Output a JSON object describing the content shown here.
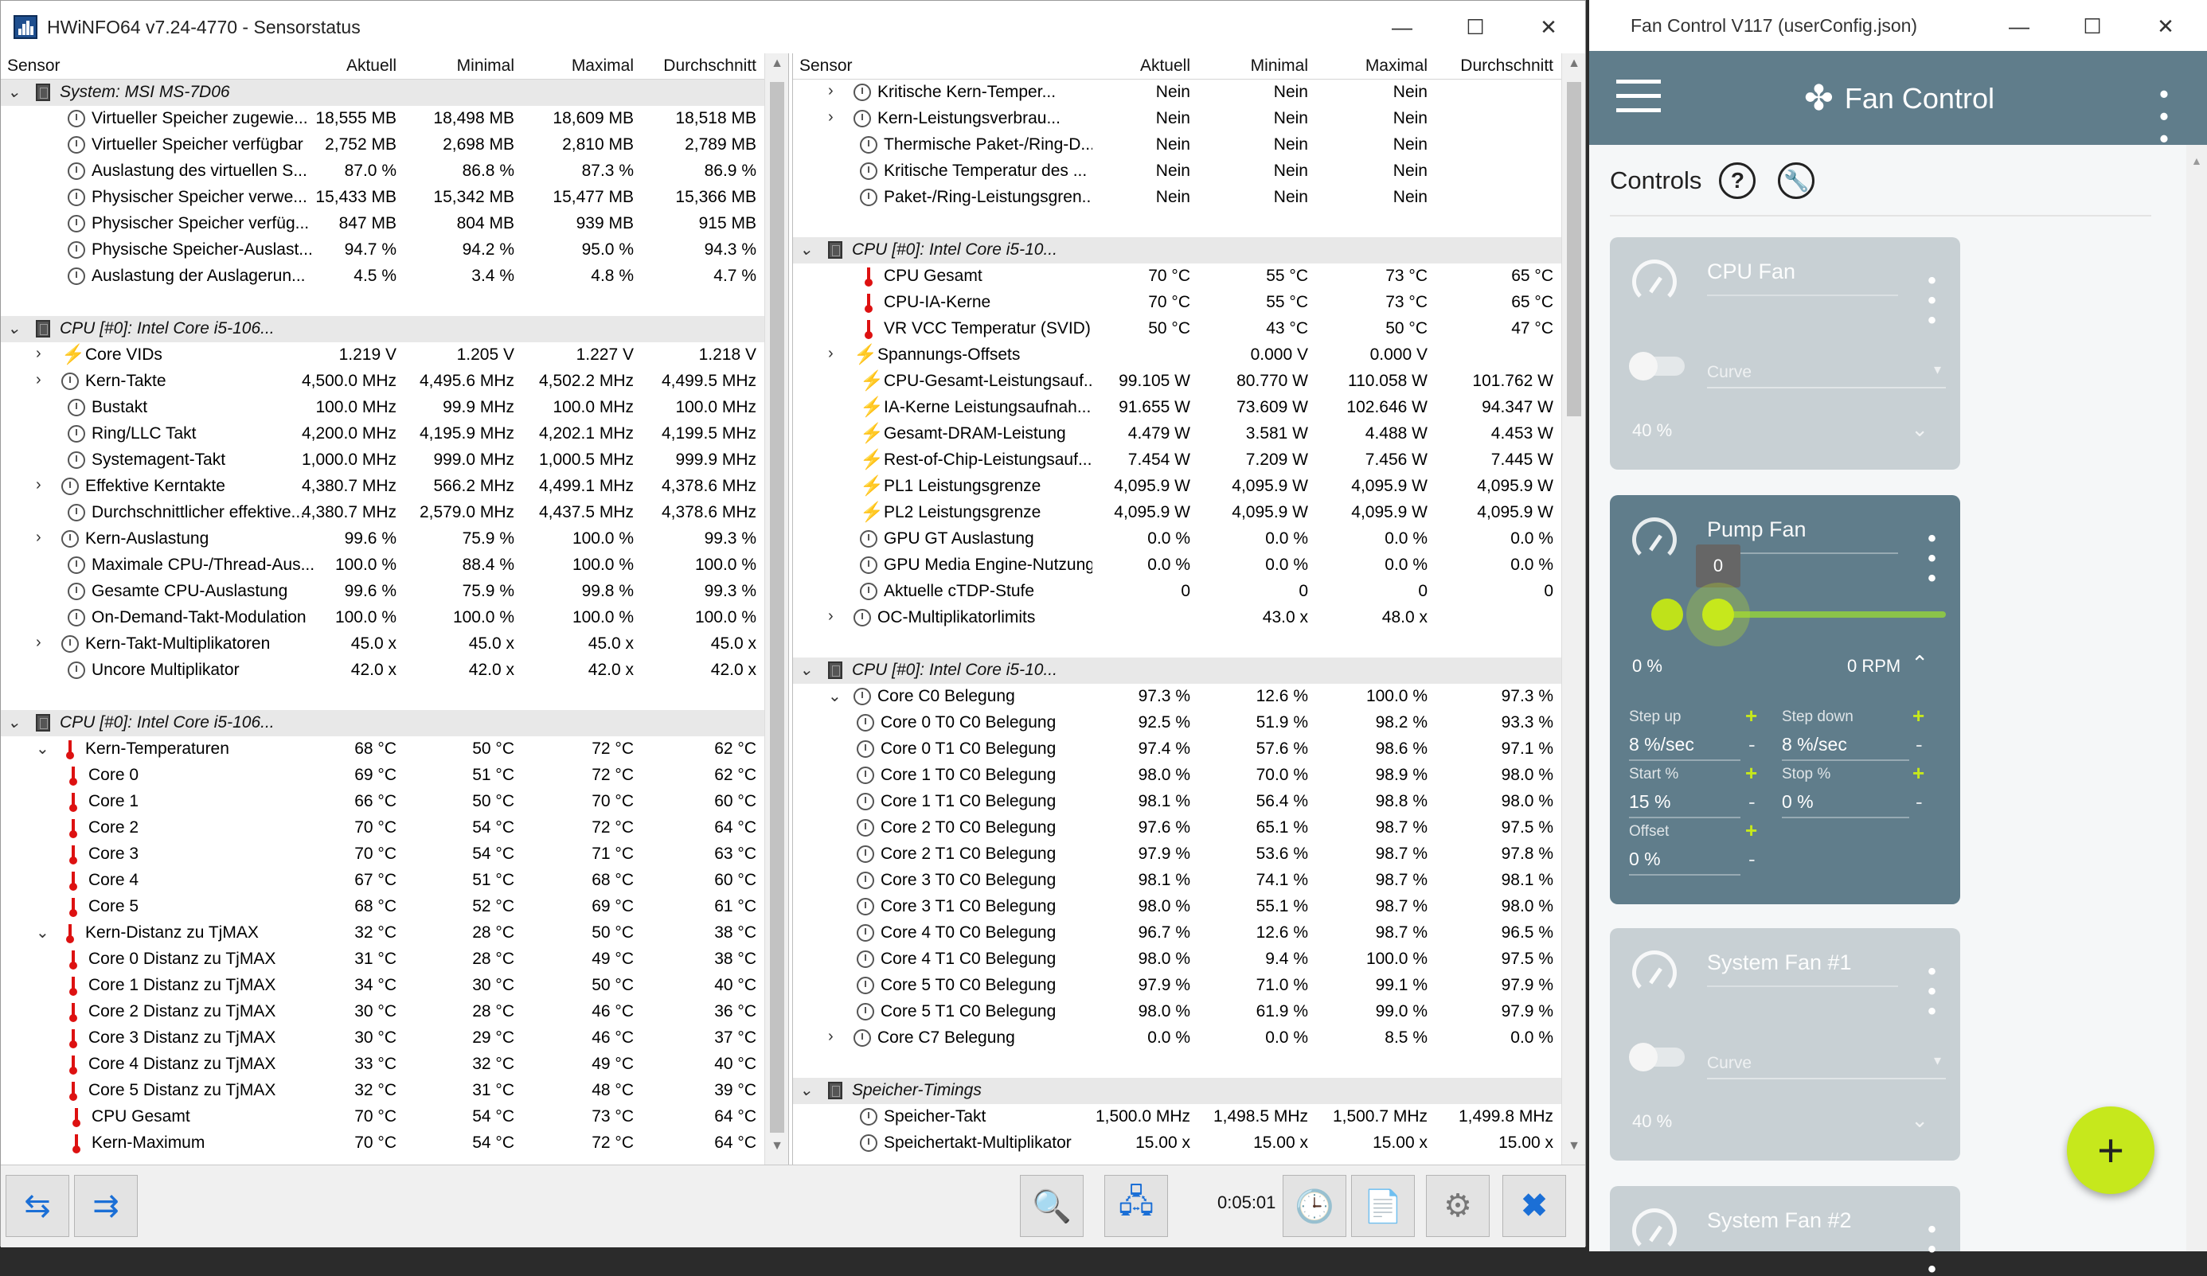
{
  "hw": {
    "title": "HWiNFO64 v7.24-4770 - Sensorstatus",
    "timer": "0:05:01",
    "headers": {
      "sensor": "Sensor",
      "current": "Aktuell",
      "min": "Minimal",
      "max": "Maximal",
      "avg": "Durchschnitt"
    },
    "left_rows": [
      {
        "t": "g",
        "d": 0,
        "exp": "⌄",
        "icon": "chip",
        "name": "System: MSI MS-7D06"
      },
      {
        "d": 1,
        "icon": "clk",
        "name": "Virtueller Speicher zugewie...",
        "v": [
          "18,555 MB",
          "18,498 MB",
          "18,609 MB",
          "18,518 MB"
        ]
      },
      {
        "d": 1,
        "icon": "clk",
        "name": "Virtueller Speicher verfügbar",
        "v": [
          "2,752 MB",
          "2,698 MB",
          "2,810 MB",
          "2,789 MB"
        ]
      },
      {
        "d": 1,
        "icon": "clk",
        "name": "Auslastung des virtuellen S...",
        "v": [
          "87.0 %",
          "86.8 %",
          "87.3 %",
          "86.9 %"
        ]
      },
      {
        "d": 1,
        "icon": "clk",
        "name": "Physischer Speicher verwe...",
        "v": [
          "15,433 MB",
          "15,342 MB",
          "15,477 MB",
          "15,366 MB"
        ]
      },
      {
        "d": 1,
        "icon": "clk",
        "name": "Physischer Speicher verfüg...",
        "v": [
          "847 MB",
          "804 MB",
          "939 MB",
          "915 MB"
        ]
      },
      {
        "d": 1,
        "icon": "clk",
        "name": "Physische Speicher-Auslast...",
        "v": [
          "94.7 %",
          "94.2 %",
          "95.0 %",
          "94.3 %"
        ]
      },
      {
        "d": 1,
        "icon": "clk",
        "name": "Auslastung der Auslagerun...",
        "v": [
          "4.5 %",
          "3.4 %",
          "4.8 %",
          "4.7 %"
        ]
      },
      {
        "t": "e"
      },
      {
        "t": "g",
        "d": 0,
        "exp": "⌄",
        "icon": "chip",
        "name": "CPU [#0]: Intel Core i5-106..."
      },
      {
        "d": 1,
        "exp": ">",
        "icon": "bolt",
        "name": "Core VIDs",
        "v": [
          "1.219 V",
          "1.205 V",
          "1.227 V",
          "1.218 V"
        ]
      },
      {
        "d": 1,
        "exp": ">",
        "icon": "clk",
        "name": "Kern-Takte",
        "v": [
          "4,500.0 MHz",
          "4,495.6 MHz",
          "4,502.2 MHz",
          "4,499.5 MHz"
        ]
      },
      {
        "d": 1,
        "icon": "clk",
        "name": "Bustakt",
        "v": [
          "100.0 MHz",
          "99.9 MHz",
          "100.0 MHz",
          "100.0 MHz"
        ]
      },
      {
        "d": 1,
        "icon": "clk",
        "name": "Ring/LLC Takt",
        "v": [
          "4,200.0 MHz",
          "4,195.9 MHz",
          "4,202.1 MHz",
          "4,199.5 MHz"
        ]
      },
      {
        "d": 1,
        "icon": "clk",
        "name": "Systemagent-Takt",
        "v": [
          "1,000.0 MHz",
          "999.0 MHz",
          "1,000.5 MHz",
          "999.9 MHz"
        ]
      },
      {
        "d": 1,
        "exp": ">",
        "icon": "clk",
        "name": "Effektive Kerntakte",
        "v": [
          "4,380.7 MHz",
          "566.2 MHz",
          "4,499.1 MHz",
          "4,378.6 MHz"
        ]
      },
      {
        "d": 1,
        "icon": "clk",
        "name": "Durchschnittlicher effektive...",
        "v": [
          "4,380.7 MHz",
          "2,579.0 MHz",
          "4,437.5 MHz",
          "4,378.6 MHz"
        ]
      },
      {
        "d": 1,
        "exp": ">",
        "icon": "clk",
        "name": "Kern-Auslastung",
        "v": [
          "99.6 %",
          "75.9 %",
          "100.0 %",
          "99.3 %"
        ]
      },
      {
        "d": 1,
        "icon": "clk",
        "name": "Maximale CPU-/Thread-Aus...",
        "v": [
          "100.0 %",
          "88.4 %",
          "100.0 %",
          "100.0 %"
        ]
      },
      {
        "d": 1,
        "icon": "clk",
        "name": "Gesamte CPU-Auslastung",
        "v": [
          "99.6 %",
          "75.9 %",
          "99.8 %",
          "99.3 %"
        ]
      },
      {
        "d": 1,
        "icon": "clk",
        "name": "On-Demand-Takt-Modulation",
        "v": [
          "100.0 %",
          "100.0 %",
          "100.0 %",
          "100.0 %"
        ]
      },
      {
        "d": 1,
        "exp": ">",
        "icon": "clk",
        "name": "Kern-Takt-Multiplikatoren",
        "v": [
          "45.0 x",
          "45.0 x",
          "45.0 x",
          "45.0 x"
        ]
      },
      {
        "d": 1,
        "icon": "clk",
        "name": "Uncore Multiplikator",
        "v": [
          "42.0 x",
          "42.0 x",
          "42.0 x",
          "42.0 x"
        ]
      },
      {
        "t": "e"
      },
      {
        "t": "g",
        "d": 0,
        "exp": "⌄",
        "icon": "chip",
        "name": "CPU [#0]: Intel Core i5-106..."
      },
      {
        "d": 1,
        "exp": "⌄",
        "icon": "thm",
        "name": "Kern-Temperaturen",
        "v": [
          "68 °C",
          "50 °C",
          "72 °C",
          "62 °C"
        ]
      },
      {
        "d": 2,
        "icon": "thm",
        "name": "Core 0",
        "v": [
          "69 °C",
          "51 °C",
          "72 °C",
          "62 °C"
        ]
      },
      {
        "d": 2,
        "icon": "thm",
        "name": "Core 1",
        "v": [
          "66 °C",
          "50 °C",
          "70 °C",
          "60 °C"
        ]
      },
      {
        "d": 2,
        "icon": "thm",
        "name": "Core 2",
        "v": [
          "70 °C",
          "54 °C",
          "72 °C",
          "64 °C"
        ]
      },
      {
        "d": 2,
        "icon": "thm",
        "name": "Core 3",
        "v": [
          "70 °C",
          "54 °C",
          "71 °C",
          "63 °C"
        ]
      },
      {
        "d": 2,
        "icon": "thm",
        "name": "Core 4",
        "v": [
          "67 °C",
          "51 °C",
          "68 °C",
          "60 °C"
        ]
      },
      {
        "d": 2,
        "icon": "thm",
        "name": "Core 5",
        "v": [
          "68 °C",
          "52 °C",
          "69 °C",
          "61 °C"
        ]
      },
      {
        "d": 1,
        "exp": "⌄",
        "icon": "thm",
        "name": "Kern-Distanz zu TjMAX",
        "v": [
          "32 °C",
          "28 °C",
          "50 °C",
          "38 °C"
        ]
      },
      {
        "d": 2,
        "icon": "thm",
        "name": "Core 0 Distanz zu TjMAX",
        "v": [
          "31 °C",
          "28 °C",
          "49 °C",
          "38 °C"
        ]
      },
      {
        "d": 2,
        "icon": "thm",
        "name": "Core 1 Distanz zu TjMAX",
        "v": [
          "34 °C",
          "30 °C",
          "50 °C",
          "40 °C"
        ]
      },
      {
        "d": 2,
        "icon": "thm",
        "name": "Core 2 Distanz zu TjMAX",
        "v": [
          "30 °C",
          "28 °C",
          "46 °C",
          "36 °C"
        ]
      },
      {
        "d": 2,
        "icon": "thm",
        "name": "Core 3 Distanz zu TjMAX",
        "v": [
          "30 °C",
          "29 °C",
          "46 °C",
          "37 °C"
        ]
      },
      {
        "d": 2,
        "icon": "thm",
        "name": "Core 4 Distanz zu TjMAX",
        "v": [
          "33 °C",
          "32 °C",
          "49 °C",
          "40 °C"
        ]
      },
      {
        "d": 2,
        "icon": "thm",
        "name": "Core 5 Distanz zu TjMAX",
        "v": [
          "32 °C",
          "31 °C",
          "48 °C",
          "39 °C"
        ]
      },
      {
        "d": 1,
        "icon": "thm",
        "name": "CPU Gesamt",
        "v": [
          "70 °C",
          "54 °C",
          "73 °C",
          "64 °C"
        ]
      },
      {
        "d": 1,
        "icon": "thm",
        "name": "Kern-Maximum",
        "v": [
          "70 °C",
          "54 °C",
          "72 °C",
          "64 °C"
        ]
      }
    ],
    "right_rows": [
      {
        "d": 1,
        "exp": ">",
        "icon": "clk",
        "name": "Kritische Kern-Temper...",
        "v": [
          "Nein",
          "Nein",
          "Nein",
          ""
        ]
      },
      {
        "d": 1,
        "exp": ">",
        "icon": "clk",
        "name": "Kern-Leistungsverbrau...",
        "v": [
          "Nein",
          "Nein",
          "Nein",
          ""
        ]
      },
      {
        "d": 1,
        "icon": "clk",
        "name": "Thermische Paket-/Ring-D...",
        "v": [
          "Nein",
          "Nein",
          "Nein",
          ""
        ]
      },
      {
        "d": 1,
        "icon": "clk",
        "name": "Kritische Temperatur des ...",
        "v": [
          "Nein",
          "Nein",
          "Nein",
          ""
        ]
      },
      {
        "d": 1,
        "icon": "clk",
        "name": "Paket-/Ring-Leistungsgren...",
        "v": [
          "Nein",
          "Nein",
          "Nein",
          ""
        ]
      },
      {
        "t": "e"
      },
      {
        "t": "g",
        "d": 0,
        "exp": "⌄",
        "icon": "chip",
        "name": "CPU [#0]: Intel Core i5-10..."
      },
      {
        "d": 1,
        "icon": "thm",
        "name": "CPU Gesamt",
        "v": [
          "70 °C",
          "55 °C",
          "73 °C",
          "65 °C"
        ]
      },
      {
        "d": 1,
        "icon": "thm",
        "name": "CPU-IA-Kerne",
        "v": [
          "70 °C",
          "55 °C",
          "73 °C",
          "65 °C"
        ]
      },
      {
        "d": 1,
        "icon": "thm",
        "name": "VR VCC Temperatur (SVID)",
        "v": [
          "50 °C",
          "43 °C",
          "50 °C",
          "47 °C"
        ]
      },
      {
        "d": 1,
        "exp": ">",
        "icon": "bolt",
        "name": "Spannungs-Offsets",
        "v": [
          "",
          "0.000 V",
          "0.000 V",
          ""
        ]
      },
      {
        "d": 1,
        "icon": "bolt",
        "name": "CPU-Gesamt-Leistungsauf...",
        "v": [
          "99.105 W",
          "80.770 W",
          "110.058 W",
          "101.762 W"
        ]
      },
      {
        "d": 1,
        "icon": "bolt",
        "name": "IA-Kerne Leistungsaufnah...",
        "v": [
          "91.655 W",
          "73.609 W",
          "102.646 W",
          "94.347 W"
        ]
      },
      {
        "d": 1,
        "icon": "bolt",
        "name": "Gesamt-DRAM-Leistung",
        "v": [
          "4.479 W",
          "3.581 W",
          "4.488 W",
          "4.453 W"
        ]
      },
      {
        "d": 1,
        "icon": "bolt",
        "name": "Rest-of-Chip-Leistungsauf...",
        "v": [
          "7.454 W",
          "7.209 W",
          "7.456 W",
          "7.445 W"
        ]
      },
      {
        "d": 1,
        "icon": "bolt",
        "name": "PL1 Leistungsgrenze",
        "v": [
          "4,095.9 W",
          "4,095.9 W",
          "4,095.9 W",
          "4,095.9 W"
        ]
      },
      {
        "d": 1,
        "icon": "bolt",
        "name": "PL2 Leistungsgrenze",
        "v": [
          "4,095.9 W",
          "4,095.9 W",
          "4,095.9 W",
          "4,095.9 W"
        ]
      },
      {
        "d": 1,
        "icon": "clk",
        "name": "GPU GT Auslastung",
        "v": [
          "0.0 %",
          "0.0 %",
          "0.0 %",
          "0.0 %"
        ]
      },
      {
        "d": 1,
        "icon": "clk",
        "name": "GPU Media Engine-Nutzung",
        "v": [
          "0.0 %",
          "0.0 %",
          "0.0 %",
          "0.0 %"
        ]
      },
      {
        "d": 1,
        "icon": "clk",
        "name": "Aktuelle cTDP-Stufe",
        "v": [
          "0",
          "0",
          "0",
          "0"
        ]
      },
      {
        "d": 1,
        "exp": ">",
        "icon": "clk",
        "name": "OC-Multiplikatorlimits",
        "v": [
          "",
          "43.0 x",
          "48.0 x",
          ""
        ]
      },
      {
        "t": "e"
      },
      {
        "t": "g",
        "d": 0,
        "exp": "⌄",
        "icon": "chip",
        "name": "CPU [#0]: Intel Core i5-10..."
      },
      {
        "d": 1,
        "exp": "⌄",
        "icon": "clk",
        "name": "Core C0 Belegung",
        "v": [
          "97.3 %",
          "12.6 %",
          "100.0 %",
          "97.3 %"
        ]
      },
      {
        "d": 2,
        "icon": "clk",
        "name": "Core 0 T0 C0 Belegung",
        "v": [
          "92.5 %",
          "51.9 %",
          "98.2 %",
          "93.3 %"
        ]
      },
      {
        "d": 2,
        "icon": "clk",
        "name": "Core 0 T1 C0 Belegung",
        "v": [
          "97.4 %",
          "57.6 %",
          "98.6 %",
          "97.1 %"
        ]
      },
      {
        "d": 2,
        "icon": "clk",
        "name": "Core 1 T0 C0 Belegung",
        "v": [
          "98.0 %",
          "70.0 %",
          "98.9 %",
          "98.0 %"
        ]
      },
      {
        "d": 2,
        "icon": "clk",
        "name": "Core 1 T1 C0 Belegung",
        "v": [
          "98.1 %",
          "56.4 %",
          "98.8 %",
          "98.0 %"
        ]
      },
      {
        "d": 2,
        "icon": "clk",
        "name": "Core 2 T0 C0 Belegung",
        "v": [
          "97.6 %",
          "65.1 %",
          "98.7 %",
          "97.5 %"
        ]
      },
      {
        "d": 2,
        "icon": "clk",
        "name": "Core 2 T1 C0 Belegung",
        "v": [
          "97.9 %",
          "53.6 %",
          "98.7 %",
          "97.8 %"
        ]
      },
      {
        "d": 2,
        "icon": "clk",
        "name": "Core 3 T0 C0 Belegung",
        "v": [
          "98.1 %",
          "74.1 %",
          "98.7 %",
          "98.1 %"
        ]
      },
      {
        "d": 2,
        "icon": "clk",
        "name": "Core 3 T1 C0 Belegung",
        "v": [
          "98.0 %",
          "55.1 %",
          "98.7 %",
          "98.0 %"
        ]
      },
      {
        "d": 2,
        "icon": "clk",
        "name": "Core 4 T0 C0 Belegung",
        "v": [
          "96.7 %",
          "12.6 %",
          "98.7 %",
          "96.5 %"
        ]
      },
      {
        "d": 2,
        "icon": "clk",
        "name": "Core 4 T1 C0 Belegung",
        "v": [
          "98.0 %",
          "9.4 %",
          "100.0 %",
          "97.5 %"
        ]
      },
      {
        "d": 2,
        "icon": "clk",
        "name": "Core 5 T0 C0 Belegung",
        "v": [
          "97.9 %",
          "71.0 %",
          "99.1 %",
          "97.9 %"
        ]
      },
      {
        "d": 2,
        "icon": "clk",
        "name": "Core 5 T1 C0 Belegung",
        "v": [
          "98.0 %",
          "61.9 %",
          "99.0 %",
          "97.9 %"
        ]
      },
      {
        "d": 1,
        "exp": ">",
        "icon": "clk",
        "name": "Core C7 Belegung",
        "v": [
          "0.0 %",
          "0.0 %",
          "8.5 %",
          "0.0 %"
        ]
      },
      {
        "t": "e"
      },
      {
        "t": "g",
        "d": 0,
        "exp": "⌄",
        "icon": "chip",
        "name": "Speicher-Timings"
      },
      {
        "d": 1,
        "icon": "clk",
        "name": "Speicher-Takt",
        "v": [
          "1,500.0 MHz",
          "1,498.5 MHz",
          "1,500.7 MHz",
          "1,499.8 MHz"
        ]
      },
      {
        "d": 1,
        "icon": "clk",
        "name": "Speichertakt-Multiplikator",
        "v": [
          "15.00 x",
          "15.00 x",
          "15.00 x",
          "15.00 x"
        ]
      }
    ]
  },
  "fc": {
    "title": "Fan Control V117 (userConfig.json)",
    "brand": "Fan Control",
    "controls_label": "Controls",
    "help": "?",
    "cards": [
      {
        "name": "CPU Fan",
        "curve": "Curve",
        "pct": "40 %"
      },
      {
        "name": "Pump Fan",
        "tooltip": "0",
        "pct": "0 %",
        "rpm": "0 RPM",
        "step_up_label": "Step up",
        "step_up": "8 %/sec",
        "step_down_label": "Step down",
        "step_down": "8 %/sec",
        "start_label": "Start %",
        "start": "15 %",
        "stop_label": "Stop %",
        "stop": "0 %",
        "offset_label": "Offset",
        "offset": "0 %"
      },
      {
        "name": "System Fan #1",
        "curve": "Curve",
        "pct": "40 %"
      },
      {
        "name": "System Fan #2"
      }
    ],
    "accent": "#c6e81c",
    "header_color": "#607d8b"
  }
}
